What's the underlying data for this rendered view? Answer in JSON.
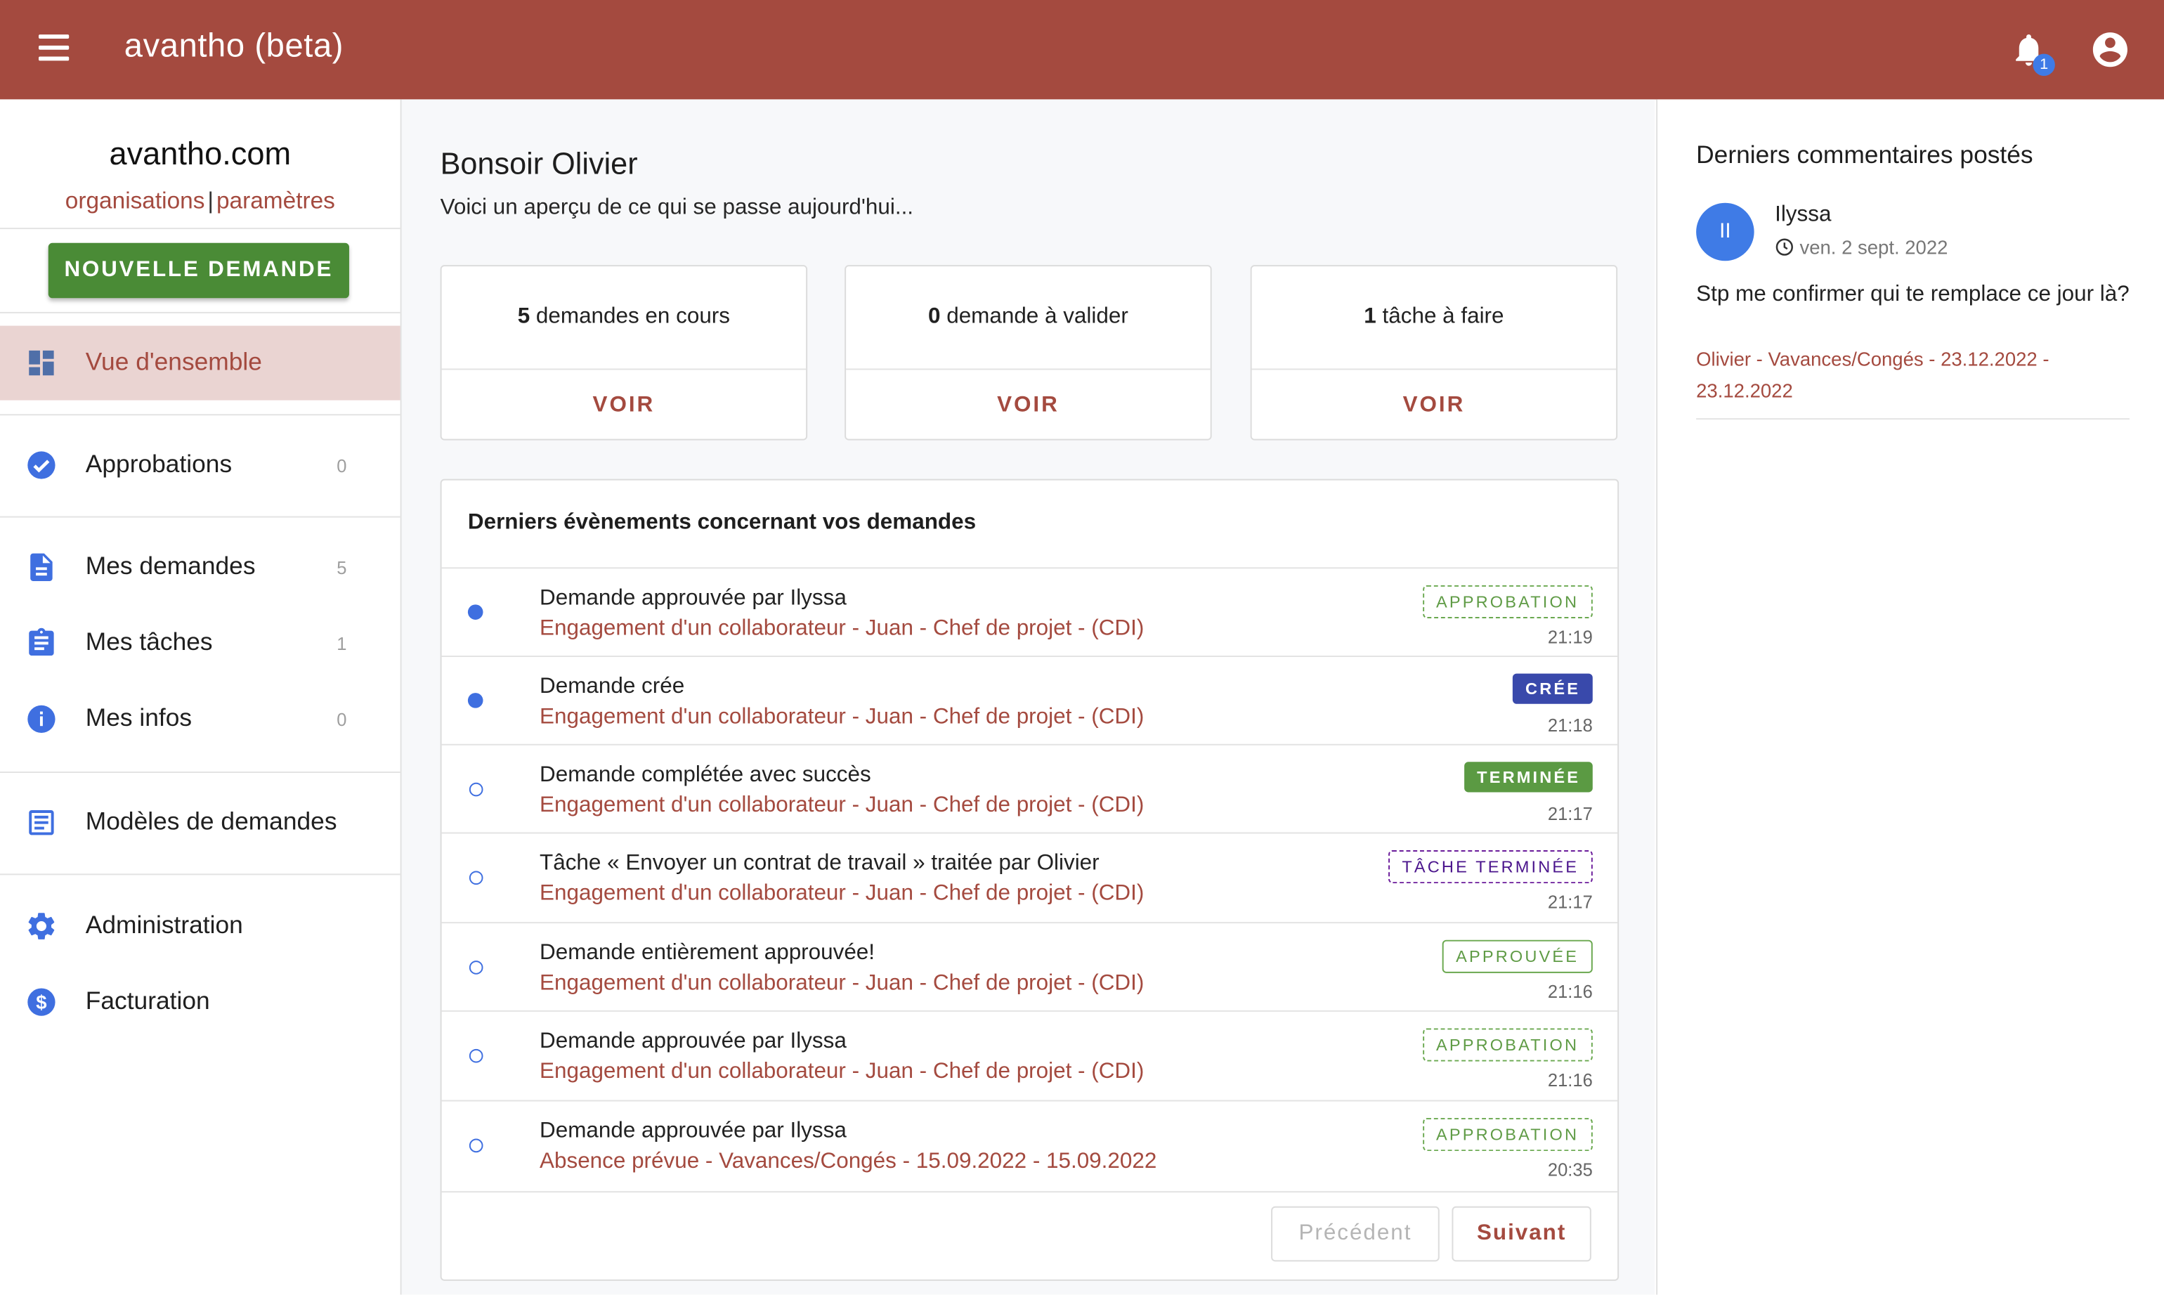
{
  "topbar": {
    "title": "avantho (beta)",
    "notification_count": "1"
  },
  "sidebar": {
    "org_name": "avantho.com",
    "links": {
      "organisations": "organisations",
      "separator": "|",
      "parametres": "paramètres"
    },
    "new_request_label": "NOUVELLE DEMANDE",
    "items": [
      {
        "label": "Vue d'ensemble",
        "count": "",
        "icon": "dashboard-icon"
      },
      {
        "label": "Approbations",
        "count": "0",
        "icon": "check-circle-icon"
      },
      {
        "label": "Mes demandes",
        "count": "5",
        "icon": "document-icon"
      },
      {
        "label": "Mes tâches",
        "count": "1",
        "icon": "clipboard-icon"
      },
      {
        "label": "Mes infos",
        "count": "0",
        "icon": "info-icon"
      },
      {
        "label": "Modèles de demandes",
        "count": "",
        "icon": "template-icon"
      },
      {
        "label": "Administration",
        "count": "",
        "icon": "gear-icon"
      },
      {
        "label": "Facturation",
        "count": "",
        "icon": "dollar-icon"
      }
    ]
  },
  "main": {
    "greeting": "Bonsoir Olivier",
    "subtitle": "Voici un aperçu de ce qui se passe aujourd'hui...",
    "cards": [
      {
        "count": "5",
        "text": " demandes en cours",
        "action": "VOIR"
      },
      {
        "count": "0",
        "text": " demande à valider",
        "action": "VOIR"
      },
      {
        "count": "1",
        "text": " tâche à faire",
        "action": "VOIR"
      }
    ],
    "events": {
      "title": "Derniers évènements concernant vos demandes",
      "rows": [
        {
          "title": "Demande approuvée par Ilyssa",
          "subtitle": "Engagement d'un collaborateur - Juan - Chef de projet - (CDI)",
          "tag": "APPROBATION",
          "time": "21:19"
        },
        {
          "title": "Demande crée",
          "subtitle": "Engagement d'un collaborateur - Juan - Chef de projet - (CDI)",
          "tag": "CRÉE",
          "time": "21:18"
        },
        {
          "title": "Demande complétée avec succès",
          "subtitle": "Engagement d'un collaborateur - Juan - Chef de projet - (CDI)",
          "tag": "TERMINÉE",
          "time": "21:17"
        },
        {
          "title": "Tâche « Envoyer un contrat de travail » traitée par Olivier",
          "subtitle": "Engagement d'un collaborateur - Juan - Chef de projet - (CDI)",
          "tag": "TÂCHE TERMINÉE",
          "time": "21:17"
        },
        {
          "title": "Demande entièrement approuvée!",
          "subtitle": "Engagement d'un collaborateur - Juan - Chef de projet - (CDI)",
          "tag": "APPROUVÉE",
          "time": "21:16"
        },
        {
          "title": "Demande approuvée par Ilyssa",
          "subtitle": "Engagement d'un collaborateur - Juan - Chef de projet - (CDI)",
          "tag": "APPROBATION",
          "time": "21:16"
        },
        {
          "title": "Demande approuvée par Ilyssa",
          "subtitle": "Absence prévue - Vavances/Congés - 15.09.2022 - 15.09.2022",
          "tag": "APPROBATION",
          "time": "20:35"
        }
      ],
      "prev_label": "Précédent",
      "next_label": "Suivant"
    }
  },
  "right": {
    "title": "Derniers commentaires postés",
    "comment": {
      "avatar_initials": "II",
      "user": "Ilyssa",
      "date": "ven. 2 sept. 2022",
      "text": "Stp me confirmer qui te remplace ce jour là?",
      "reference": "Olivier - Vavances/Congés - 23.12.2022 - 23.12.2022"
    }
  },
  "colors": {
    "brand": "#a44a3f",
    "primary_button": "#4a8b36",
    "accent_blue": "#3f7be6"
  }
}
